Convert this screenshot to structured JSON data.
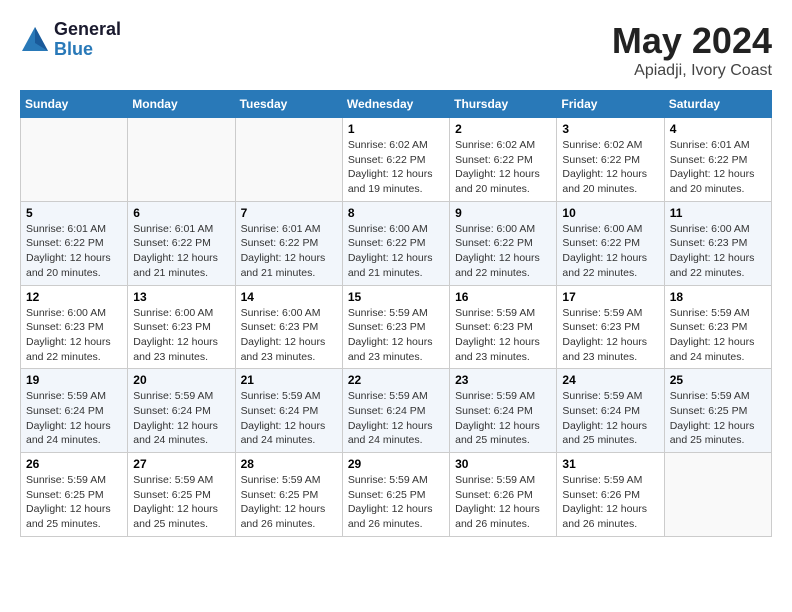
{
  "logo": {
    "general": "General",
    "blue": "Blue"
  },
  "title": "May 2024",
  "location": "Apiadji, Ivory Coast",
  "weekdays": [
    "Sunday",
    "Monday",
    "Tuesday",
    "Wednesday",
    "Thursday",
    "Friday",
    "Saturday"
  ],
  "weeks": [
    [
      {
        "day": "",
        "info": ""
      },
      {
        "day": "",
        "info": ""
      },
      {
        "day": "",
        "info": ""
      },
      {
        "day": "1",
        "info": "Sunrise: 6:02 AM\nSunset: 6:22 PM\nDaylight: 12 hours and 19 minutes."
      },
      {
        "day": "2",
        "info": "Sunrise: 6:02 AM\nSunset: 6:22 PM\nDaylight: 12 hours and 20 minutes."
      },
      {
        "day": "3",
        "info": "Sunrise: 6:02 AM\nSunset: 6:22 PM\nDaylight: 12 hours and 20 minutes."
      },
      {
        "day": "4",
        "info": "Sunrise: 6:01 AM\nSunset: 6:22 PM\nDaylight: 12 hours and 20 minutes."
      }
    ],
    [
      {
        "day": "5",
        "info": "Sunrise: 6:01 AM\nSunset: 6:22 PM\nDaylight: 12 hours and 20 minutes."
      },
      {
        "day": "6",
        "info": "Sunrise: 6:01 AM\nSunset: 6:22 PM\nDaylight: 12 hours and 21 minutes."
      },
      {
        "day": "7",
        "info": "Sunrise: 6:01 AM\nSunset: 6:22 PM\nDaylight: 12 hours and 21 minutes."
      },
      {
        "day": "8",
        "info": "Sunrise: 6:00 AM\nSunset: 6:22 PM\nDaylight: 12 hours and 21 minutes."
      },
      {
        "day": "9",
        "info": "Sunrise: 6:00 AM\nSunset: 6:22 PM\nDaylight: 12 hours and 22 minutes."
      },
      {
        "day": "10",
        "info": "Sunrise: 6:00 AM\nSunset: 6:22 PM\nDaylight: 12 hours and 22 minutes."
      },
      {
        "day": "11",
        "info": "Sunrise: 6:00 AM\nSunset: 6:23 PM\nDaylight: 12 hours and 22 minutes."
      }
    ],
    [
      {
        "day": "12",
        "info": "Sunrise: 6:00 AM\nSunset: 6:23 PM\nDaylight: 12 hours and 22 minutes."
      },
      {
        "day": "13",
        "info": "Sunrise: 6:00 AM\nSunset: 6:23 PM\nDaylight: 12 hours and 23 minutes."
      },
      {
        "day": "14",
        "info": "Sunrise: 6:00 AM\nSunset: 6:23 PM\nDaylight: 12 hours and 23 minutes."
      },
      {
        "day": "15",
        "info": "Sunrise: 5:59 AM\nSunset: 6:23 PM\nDaylight: 12 hours and 23 minutes."
      },
      {
        "day": "16",
        "info": "Sunrise: 5:59 AM\nSunset: 6:23 PM\nDaylight: 12 hours and 23 minutes."
      },
      {
        "day": "17",
        "info": "Sunrise: 5:59 AM\nSunset: 6:23 PM\nDaylight: 12 hours and 23 minutes."
      },
      {
        "day": "18",
        "info": "Sunrise: 5:59 AM\nSunset: 6:23 PM\nDaylight: 12 hours and 24 minutes."
      }
    ],
    [
      {
        "day": "19",
        "info": "Sunrise: 5:59 AM\nSunset: 6:24 PM\nDaylight: 12 hours and 24 minutes."
      },
      {
        "day": "20",
        "info": "Sunrise: 5:59 AM\nSunset: 6:24 PM\nDaylight: 12 hours and 24 minutes."
      },
      {
        "day": "21",
        "info": "Sunrise: 5:59 AM\nSunset: 6:24 PM\nDaylight: 12 hours and 24 minutes."
      },
      {
        "day": "22",
        "info": "Sunrise: 5:59 AM\nSunset: 6:24 PM\nDaylight: 12 hours and 24 minutes."
      },
      {
        "day": "23",
        "info": "Sunrise: 5:59 AM\nSunset: 6:24 PM\nDaylight: 12 hours and 25 minutes."
      },
      {
        "day": "24",
        "info": "Sunrise: 5:59 AM\nSunset: 6:24 PM\nDaylight: 12 hours and 25 minutes."
      },
      {
        "day": "25",
        "info": "Sunrise: 5:59 AM\nSunset: 6:25 PM\nDaylight: 12 hours and 25 minutes."
      }
    ],
    [
      {
        "day": "26",
        "info": "Sunrise: 5:59 AM\nSunset: 6:25 PM\nDaylight: 12 hours and 25 minutes."
      },
      {
        "day": "27",
        "info": "Sunrise: 5:59 AM\nSunset: 6:25 PM\nDaylight: 12 hours and 25 minutes."
      },
      {
        "day": "28",
        "info": "Sunrise: 5:59 AM\nSunset: 6:25 PM\nDaylight: 12 hours and 26 minutes."
      },
      {
        "day": "29",
        "info": "Sunrise: 5:59 AM\nSunset: 6:25 PM\nDaylight: 12 hours and 26 minutes."
      },
      {
        "day": "30",
        "info": "Sunrise: 5:59 AM\nSunset: 6:26 PM\nDaylight: 12 hours and 26 minutes."
      },
      {
        "day": "31",
        "info": "Sunrise: 5:59 AM\nSunset: 6:26 PM\nDaylight: 12 hours and 26 minutes."
      },
      {
        "day": "",
        "info": ""
      }
    ]
  ]
}
